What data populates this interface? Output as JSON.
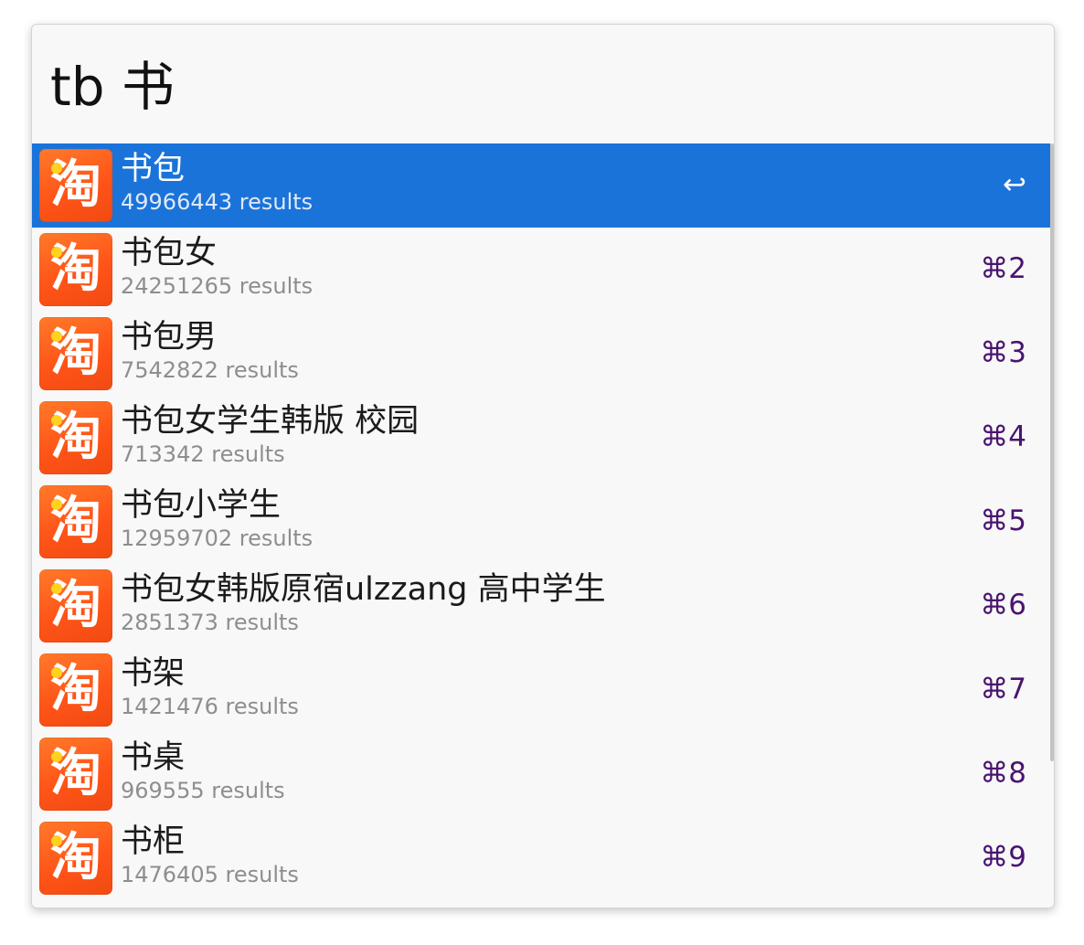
{
  "search": {
    "query": "tb 书"
  },
  "results": [
    {
      "title": "书包",
      "subtitle": "49966443 results",
      "shortcut": "↩",
      "selected": true
    },
    {
      "title": "书包女",
      "subtitle": "24251265 results",
      "shortcut": "⌘2",
      "selected": false
    },
    {
      "title": "书包男",
      "subtitle": "7542822 results",
      "shortcut": "⌘3",
      "selected": false
    },
    {
      "title": "书包女学生韩版 校园",
      "subtitle": "713342 results",
      "shortcut": "⌘4",
      "selected": false
    },
    {
      "title": "书包小学生",
      "subtitle": "12959702 results",
      "shortcut": "⌘5",
      "selected": false
    },
    {
      "title": "书包女韩版原宿ulzzang 高中学生",
      "subtitle": "2851373 results",
      "shortcut": "⌘6",
      "selected": false
    },
    {
      "title": "书架",
      "subtitle": "1421476 results",
      "shortcut": "⌘7",
      "selected": false
    },
    {
      "title": "书桌",
      "subtitle": "969555 results",
      "shortcut": "⌘8",
      "selected": false
    },
    {
      "title": "书柜",
      "subtitle": "1476405 results",
      "shortcut": "⌘9",
      "selected": false
    }
  ],
  "app_icon": {
    "name": "taobao-icon",
    "glyph": "淘"
  },
  "colors": {
    "selection": "#1a73d9",
    "shortcut": "#4a1470",
    "icon_orange": "#ff5418",
    "icon_dot": "#ffd21f"
  }
}
